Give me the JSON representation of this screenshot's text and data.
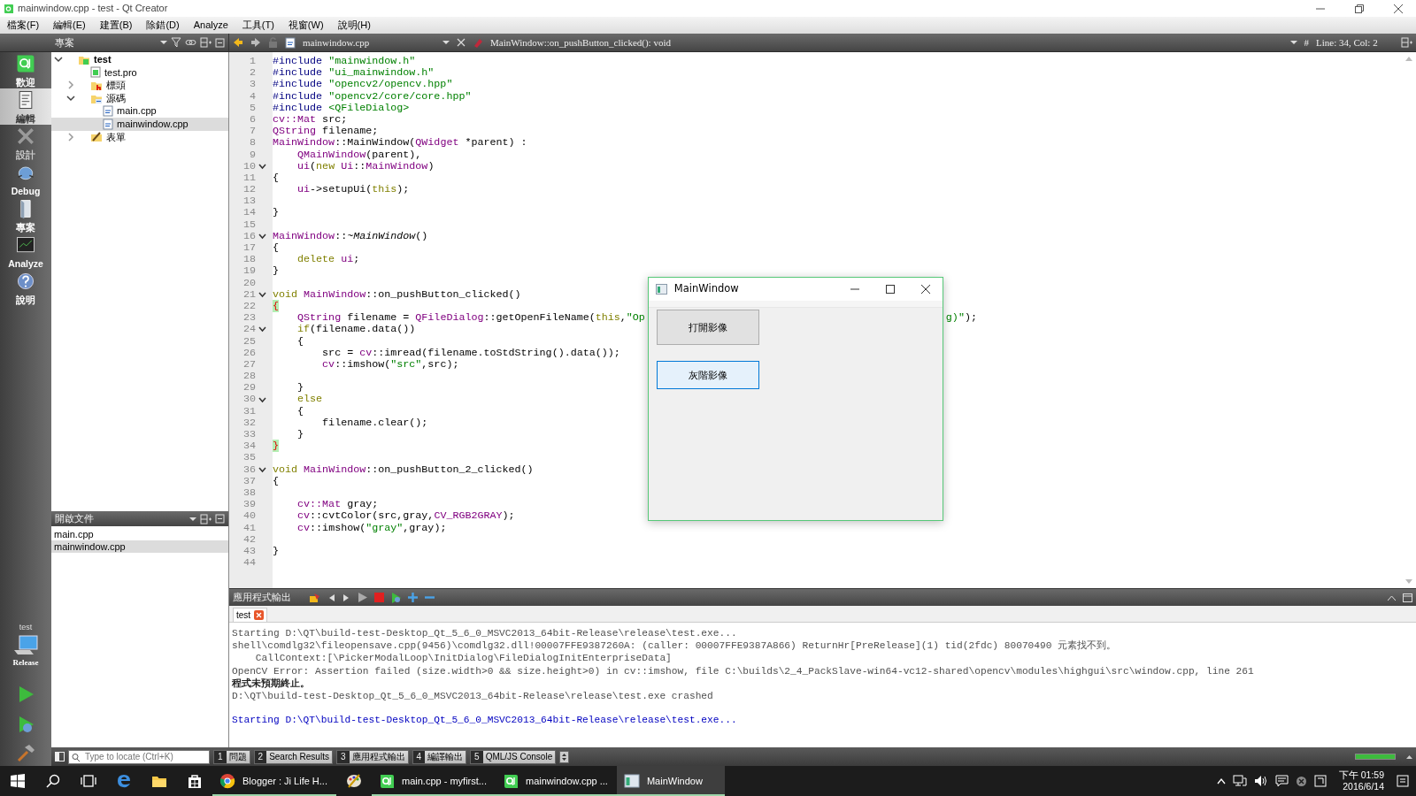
{
  "window": {
    "title": "mainwindow.cpp - test - Qt Creator"
  },
  "menu": [
    "檔案(F)",
    "編輯(E)",
    "建置(B)",
    "除錯(D)",
    "Analyze",
    "工具(T)",
    "視窗(W)",
    "說明(H)"
  ],
  "modes": [
    {
      "label": "歡迎",
      "kind": "welcome",
      "selected": false,
      "disabled": false
    },
    {
      "label": "編輯",
      "kind": "edit",
      "selected": true,
      "disabled": false
    },
    {
      "label": "設計",
      "kind": "design",
      "selected": false,
      "disabled": true
    },
    {
      "label": "Debug",
      "kind": "debug",
      "selected": false,
      "disabled": false
    },
    {
      "label": "專案",
      "kind": "projects",
      "selected": false,
      "disabled": false
    },
    {
      "label": "Analyze",
      "kind": "analyze",
      "selected": false,
      "disabled": false
    },
    {
      "label": "說明",
      "kind": "help",
      "selected": false,
      "disabled": false
    }
  ],
  "target": {
    "project": "test",
    "config": "Release"
  },
  "project_panel": {
    "title": "專案",
    "tree": [
      {
        "label": "test",
        "kind": "project",
        "expanded": true,
        "selected": false,
        "children": [
          {
            "label": "test.pro",
            "kind": "pro",
            "selected": false
          },
          {
            "label": "標頭",
            "kind": "folder-h",
            "expanded": false,
            "selected": false
          },
          {
            "label": "源碼",
            "kind": "folder-src",
            "expanded": true,
            "selected": false,
            "children": [
              {
                "label": "main.cpp",
                "kind": "cpp",
                "selected": false
              },
              {
                "label": "mainwindow.cpp",
                "kind": "cpp",
                "selected": true
              }
            ]
          },
          {
            "label": "表單",
            "kind": "folder-form",
            "expanded": false,
            "selected": false
          }
        ]
      }
    ]
  },
  "open_documents": {
    "title": "開啟文件",
    "items": [
      {
        "label": "main.cpp",
        "selected": false
      },
      {
        "label": "mainwindow.cpp",
        "selected": true
      }
    ]
  },
  "editor": {
    "file": "mainwindow.cpp",
    "symbol": "MainWindow::on_pushButton_clicked(): void",
    "hash": "#",
    "position": "Line: 34, Col: 2",
    "lines": [
      {
        "n": "1",
        "segs": [
          {
            "text": "#include ",
            "kind": "pp"
          },
          {
            "text": "\"mainwindow.h\"",
            "kind": "str"
          }
        ]
      },
      {
        "n": "2",
        "segs": [
          {
            "text": "#include ",
            "kind": "pp"
          },
          {
            "text": "\"ui_mainwindow.h\"",
            "kind": "str"
          }
        ]
      },
      {
        "n": "3",
        "segs": [
          {
            "text": "#include ",
            "kind": "pp"
          },
          {
            "text": "\"opencv2/opencv.hpp\"",
            "kind": "str"
          }
        ]
      },
      {
        "n": "4",
        "segs": [
          {
            "text": "#include ",
            "kind": "pp"
          },
          {
            "text": "\"opencv2/core/core.hpp\"",
            "kind": "str"
          }
        ]
      },
      {
        "n": "5",
        "segs": [
          {
            "text": "#include ",
            "kind": "pp"
          },
          {
            "text": "<QFileDialog>",
            "kind": "str"
          }
        ]
      },
      {
        "n": "6",
        "segs": [
          {
            "text": "cv::Mat",
            "kind": "type"
          },
          {
            "text": " src;",
            "kind": "plain"
          }
        ]
      },
      {
        "n": "7",
        "segs": [
          {
            "text": "QString",
            "kind": "type"
          },
          {
            "text": " filename;",
            "kind": "plain"
          }
        ]
      },
      {
        "n": "8",
        "segs": [
          {
            "text": "MainWindow",
            "kind": "type"
          },
          {
            "text": "::MainWindow(",
            "kind": "plain"
          },
          {
            "text": "QWidget",
            "kind": "type"
          },
          {
            "text": " *parent) :",
            "kind": "plain"
          }
        ]
      },
      {
        "n": "9",
        "segs": [
          {
            "text": "    QMainWindow",
            "kind": "type"
          },
          {
            "text": "(parent),",
            "kind": "plain"
          }
        ]
      },
      {
        "n": "10",
        "foldable": true,
        "segs": [
          {
            "text": "    ui",
            "kind": "type"
          },
          {
            "text": "(",
            "kind": "plain"
          },
          {
            "text": "new ",
            "kind": "kw"
          },
          {
            "text": "Ui",
            "kind": "type"
          },
          {
            "text": "::",
            "kind": "plain"
          },
          {
            "text": "MainWindow",
            "kind": "type"
          },
          {
            "text": ")",
            "kind": "plain"
          }
        ]
      },
      {
        "n": "11",
        "segs": [
          {
            "text": "{",
            "kind": "plain"
          }
        ]
      },
      {
        "n": "12",
        "segs": [
          {
            "text": "    ui",
            "kind": "type"
          },
          {
            "text": "->setupUi(",
            "kind": "plain"
          },
          {
            "text": "this",
            "kind": "kw"
          },
          {
            "text": ");",
            "kind": "plain"
          }
        ]
      },
      {
        "n": "13"
      },
      {
        "n": "14",
        "segs": [
          {
            "text": "}",
            "kind": "plain"
          }
        ]
      },
      {
        "n": "15"
      },
      {
        "n": "16",
        "foldable": true,
        "segs": [
          {
            "text": "MainWindow",
            "kind": "type"
          },
          {
            "text": "::",
            "kind": "plain"
          },
          {
            "text": "~MainWindow",
            "kind": "italic"
          },
          {
            "text": "()",
            "kind": "plain"
          }
        ]
      },
      {
        "n": "17",
        "segs": [
          {
            "text": "{",
            "kind": "plain"
          }
        ]
      },
      {
        "n": "18",
        "segs": [
          {
            "text": "    delete ",
            "kind": "kw"
          },
          {
            "text": "ui",
            "kind": "type"
          },
          {
            "text": ";",
            "kind": "plain"
          }
        ]
      },
      {
        "n": "19",
        "segs": [
          {
            "text": "}",
            "kind": "plain"
          }
        ]
      },
      {
        "n": "20"
      },
      {
        "n": "21",
        "foldable": true,
        "segs": [
          {
            "text": "void ",
            "kind": "kw"
          },
          {
            "text": "MainWindow",
            "kind": "type"
          },
          {
            "text": "::on_pushButton_clicked()",
            "kind": "plain"
          }
        ]
      },
      {
        "n": "22",
        "segs": [
          {
            "text": "{",
            "kind": "match"
          }
        ]
      },
      {
        "n": "23",
        "segs": [
          {
            "text": "    QString",
            "kind": "type"
          },
          {
            "text": " filename = ",
            "kind": "plain"
          },
          {
            "text": "QFileDialog",
            "kind": "type"
          },
          {
            "text": "::getOpenFileName(",
            "kind": "plain"
          },
          {
            "text": "this",
            "kind": "kw"
          },
          {
            "text": ",",
            "kind": "plain"
          },
          {
            "text": "\"Op",
            "kind": "str"
          }
        ],
        "tail": [
          {
            "text": "g)\"",
            "kind": "str"
          },
          {
            "text": ");",
            "kind": "plain"
          }
        ]
      },
      {
        "n": "24",
        "foldable": true,
        "segs": [
          {
            "text": "    if",
            "kind": "kw"
          },
          {
            "text": "(filename.data())",
            "kind": "plain"
          }
        ]
      },
      {
        "n": "25",
        "segs": [
          {
            "text": "    {",
            "kind": "plain"
          }
        ]
      },
      {
        "n": "26",
        "segs": [
          {
            "text": "        src = ",
            "kind": "plain"
          },
          {
            "text": "cv",
            "kind": "type"
          },
          {
            "text": "::imread(filename.toStdString().data());",
            "kind": "plain"
          }
        ]
      },
      {
        "n": "27",
        "segs": [
          {
            "text": "        cv",
            "kind": "type"
          },
          {
            "text": "::imshow(",
            "kind": "plain"
          },
          {
            "text": "\"src\"",
            "kind": "str"
          },
          {
            "text": ",src);",
            "kind": "plain"
          }
        ]
      },
      {
        "n": "28"
      },
      {
        "n": "29",
        "segs": [
          {
            "text": "    }",
            "kind": "plain"
          }
        ]
      },
      {
        "n": "30",
        "foldable": true,
        "segs": [
          {
            "text": "    else",
            "kind": "kw"
          }
        ]
      },
      {
        "n": "31",
        "segs": [
          {
            "text": "    {",
            "kind": "plain"
          }
        ]
      },
      {
        "n": "32",
        "segs": [
          {
            "text": "        filename.clear();",
            "kind": "plain"
          }
        ]
      },
      {
        "n": "33",
        "segs": [
          {
            "text": "    }",
            "kind": "plain"
          }
        ]
      },
      {
        "n": "34",
        "segs": [
          {
            "text": "}",
            "kind": "match"
          }
        ]
      },
      {
        "n": "35"
      },
      {
        "n": "36",
        "foldable": true,
        "segs": [
          {
            "text": "void ",
            "kind": "kw"
          },
          {
            "text": "MainWindow",
            "kind": "type"
          },
          {
            "text": "::on_pushButton_2_clicked()",
            "kind": "plain"
          }
        ]
      },
      {
        "n": "37",
        "segs": [
          {
            "text": "{",
            "kind": "plain"
          }
        ]
      },
      {
        "n": "38"
      },
      {
        "n": "39",
        "segs": [
          {
            "text": "    cv::Mat",
            "kind": "type"
          },
          {
            "text": " gray;",
            "kind": "plain"
          }
        ]
      },
      {
        "n": "40",
        "segs": [
          {
            "text": "    cv",
            "kind": "type"
          },
          {
            "text": "::cvtColor(src,gray,",
            "kind": "plain"
          },
          {
            "text": "CV_RGB2GRAY",
            "kind": "type"
          },
          {
            "text": ");",
            "kind": "plain"
          }
        ]
      },
      {
        "n": "41",
        "segs": [
          {
            "text": "    cv",
            "kind": "type"
          },
          {
            "text": "::imshow(",
            "kind": "plain"
          },
          {
            "text": "\"gray\"",
            "kind": "str"
          },
          {
            "text": ",gray);",
            "kind": "plain"
          }
        ]
      },
      {
        "n": "42"
      },
      {
        "n": "43",
        "segs": [
          {
            "text": "}",
            "kind": "plain"
          }
        ]
      },
      {
        "n": "44"
      }
    ]
  },
  "dialog": {
    "title": "MainWindow",
    "buttons": [
      {
        "label": "打開影像",
        "focused": false
      },
      {
        "label": "灰階影像",
        "focused": true
      }
    ]
  },
  "output": {
    "title": "應用程式輸出",
    "tabs": [
      {
        "label": "test",
        "selected": true
      }
    ],
    "lines": [
      {
        "text": "Starting D:\\QT\\build-test-Desktop_Qt_5_6_0_MSVC2013_64bit-Release\\release\\test.exe...",
        "kind": "plain"
      },
      {
        "text": "shell\\comdlg32\\fileopensave.cpp(9456)\\comdlg32.dll!00007FFE9387260A: (caller: 00007FFE9387A866) ReturnHr[PreRelease](1) tid(2fdc) 80070490 元素找不到。",
        "kind": "plain"
      },
      {
        "text": "    CallContext:[\\PickerModalLoop\\InitDialog\\FileDialogInitEnterpriseData]",
        "kind": "plain"
      },
      {
        "text": "OpenCV Error: Assertion failed (size.width>0 && size.height>0) in cv::imshow, file C:\\builds\\2_4_PackSlave-win64-vc12-shared\\opencv\\modules\\highgui\\src\\window.cpp, line 261",
        "kind": "plain"
      },
      {
        "text": "程式未預期終止。",
        "kind": "bold"
      },
      {
        "text": "D:\\QT\\build-test-Desktop_Qt_5_6_0_MSVC2013_64bit-Release\\release\\test.exe crashed",
        "kind": "plain"
      },
      {
        "text": "Starting D:\\QT\\build-test-Desktop_Qt_5_6_0_MSVC2013_64bit-Release\\release\\test.exe...",
        "kind": "run"
      }
    ]
  },
  "status_bar": {
    "locate_placeholder": "Type to locate (Ctrl+K)",
    "panes": [
      {
        "number": "1",
        "label": "問題"
      },
      {
        "number": "2",
        "label": "Search Results"
      },
      {
        "number": "3",
        "label": "應用程式輸出"
      },
      {
        "number": "4",
        "label": "編譯輸出"
      },
      {
        "number": "5",
        "label": "QML/JS Console"
      }
    ],
    "progress": {
      "level": 1
    }
  },
  "taskbar": {
    "items": [
      {
        "kind": "start",
        "running": false,
        "selected": false
      },
      {
        "kind": "search",
        "running": false,
        "selected": false
      },
      {
        "kind": "taskview",
        "running": false,
        "selected": false
      },
      {
        "kind": "edge",
        "running": false,
        "selected": false
      },
      {
        "kind": "explorer",
        "running": false,
        "selected": false
      },
      {
        "kind": "store",
        "running": false,
        "selected": false
      },
      {
        "kind": "chrome",
        "label": "Blogger : Ji Life H...",
        "running": true,
        "selected": false
      },
      {
        "kind": "paint",
        "running": false,
        "selected": false
      },
      {
        "kind": "qt",
        "label": "main.cpp - myfirst...",
        "running": true,
        "selected": false
      },
      {
        "kind": "qt",
        "label": "mainwindow.cpp ...",
        "running": true,
        "selected": false
      },
      {
        "kind": "window",
        "label": "MainWindow",
        "running": true,
        "selected": true
      }
    ],
    "time": "下午 01:59",
    "date": "2016/6/14"
  }
}
